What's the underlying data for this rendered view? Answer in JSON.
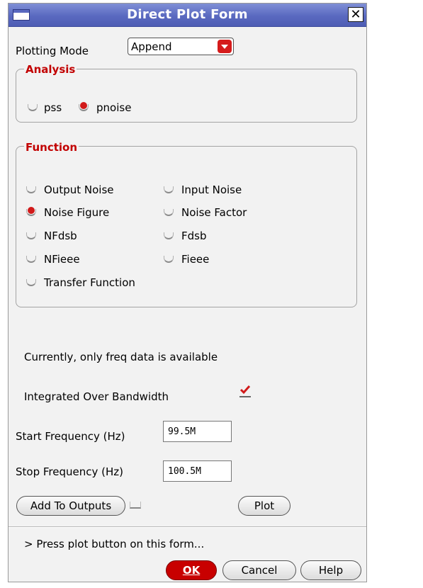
{
  "window": {
    "title": "Direct Plot Form",
    "close_glyph": "✕"
  },
  "plotting_mode": {
    "label": "Plotting Mode",
    "value": "Append"
  },
  "analysis": {
    "title": "Analysis",
    "options": [
      {
        "label": "pss",
        "selected": false
      },
      {
        "label": "pnoise",
        "selected": true
      }
    ]
  },
  "function": {
    "title": "Function",
    "options": [
      {
        "label": "Output Noise",
        "selected": false
      },
      {
        "label": "Input Noise",
        "selected": false
      },
      {
        "label": "Noise Figure",
        "selected": true
      },
      {
        "label": "Noise Factor",
        "selected": false
      },
      {
        "label": "NFdsb",
        "selected": false
      },
      {
        "label": "Fdsb",
        "selected": false
      },
      {
        "label": "NFieee",
        "selected": false
      },
      {
        "label": "Fieee",
        "selected": false
      },
      {
        "label": "Transfer Function",
        "selected": false
      }
    ]
  },
  "info_text": "Currently, only freq data is available",
  "integrated": {
    "label": "Integrated Over Bandwidth",
    "checked": true
  },
  "start_freq": {
    "label": "Start Frequency (Hz)",
    "value": "99.5M"
  },
  "stop_freq": {
    "label": "Stop Frequency (Hz)",
    "value": "100.5M"
  },
  "buttons": {
    "add_to_outputs": "Add To Outputs",
    "plot": "Plot",
    "ok": "OK",
    "cancel": "Cancel",
    "help": "Help"
  },
  "status_text": "> Press plot button on this form...",
  "colors": {
    "titlebar": "#5a69c0",
    "accent_red": "#c20000",
    "background": "#f2f2f2"
  }
}
